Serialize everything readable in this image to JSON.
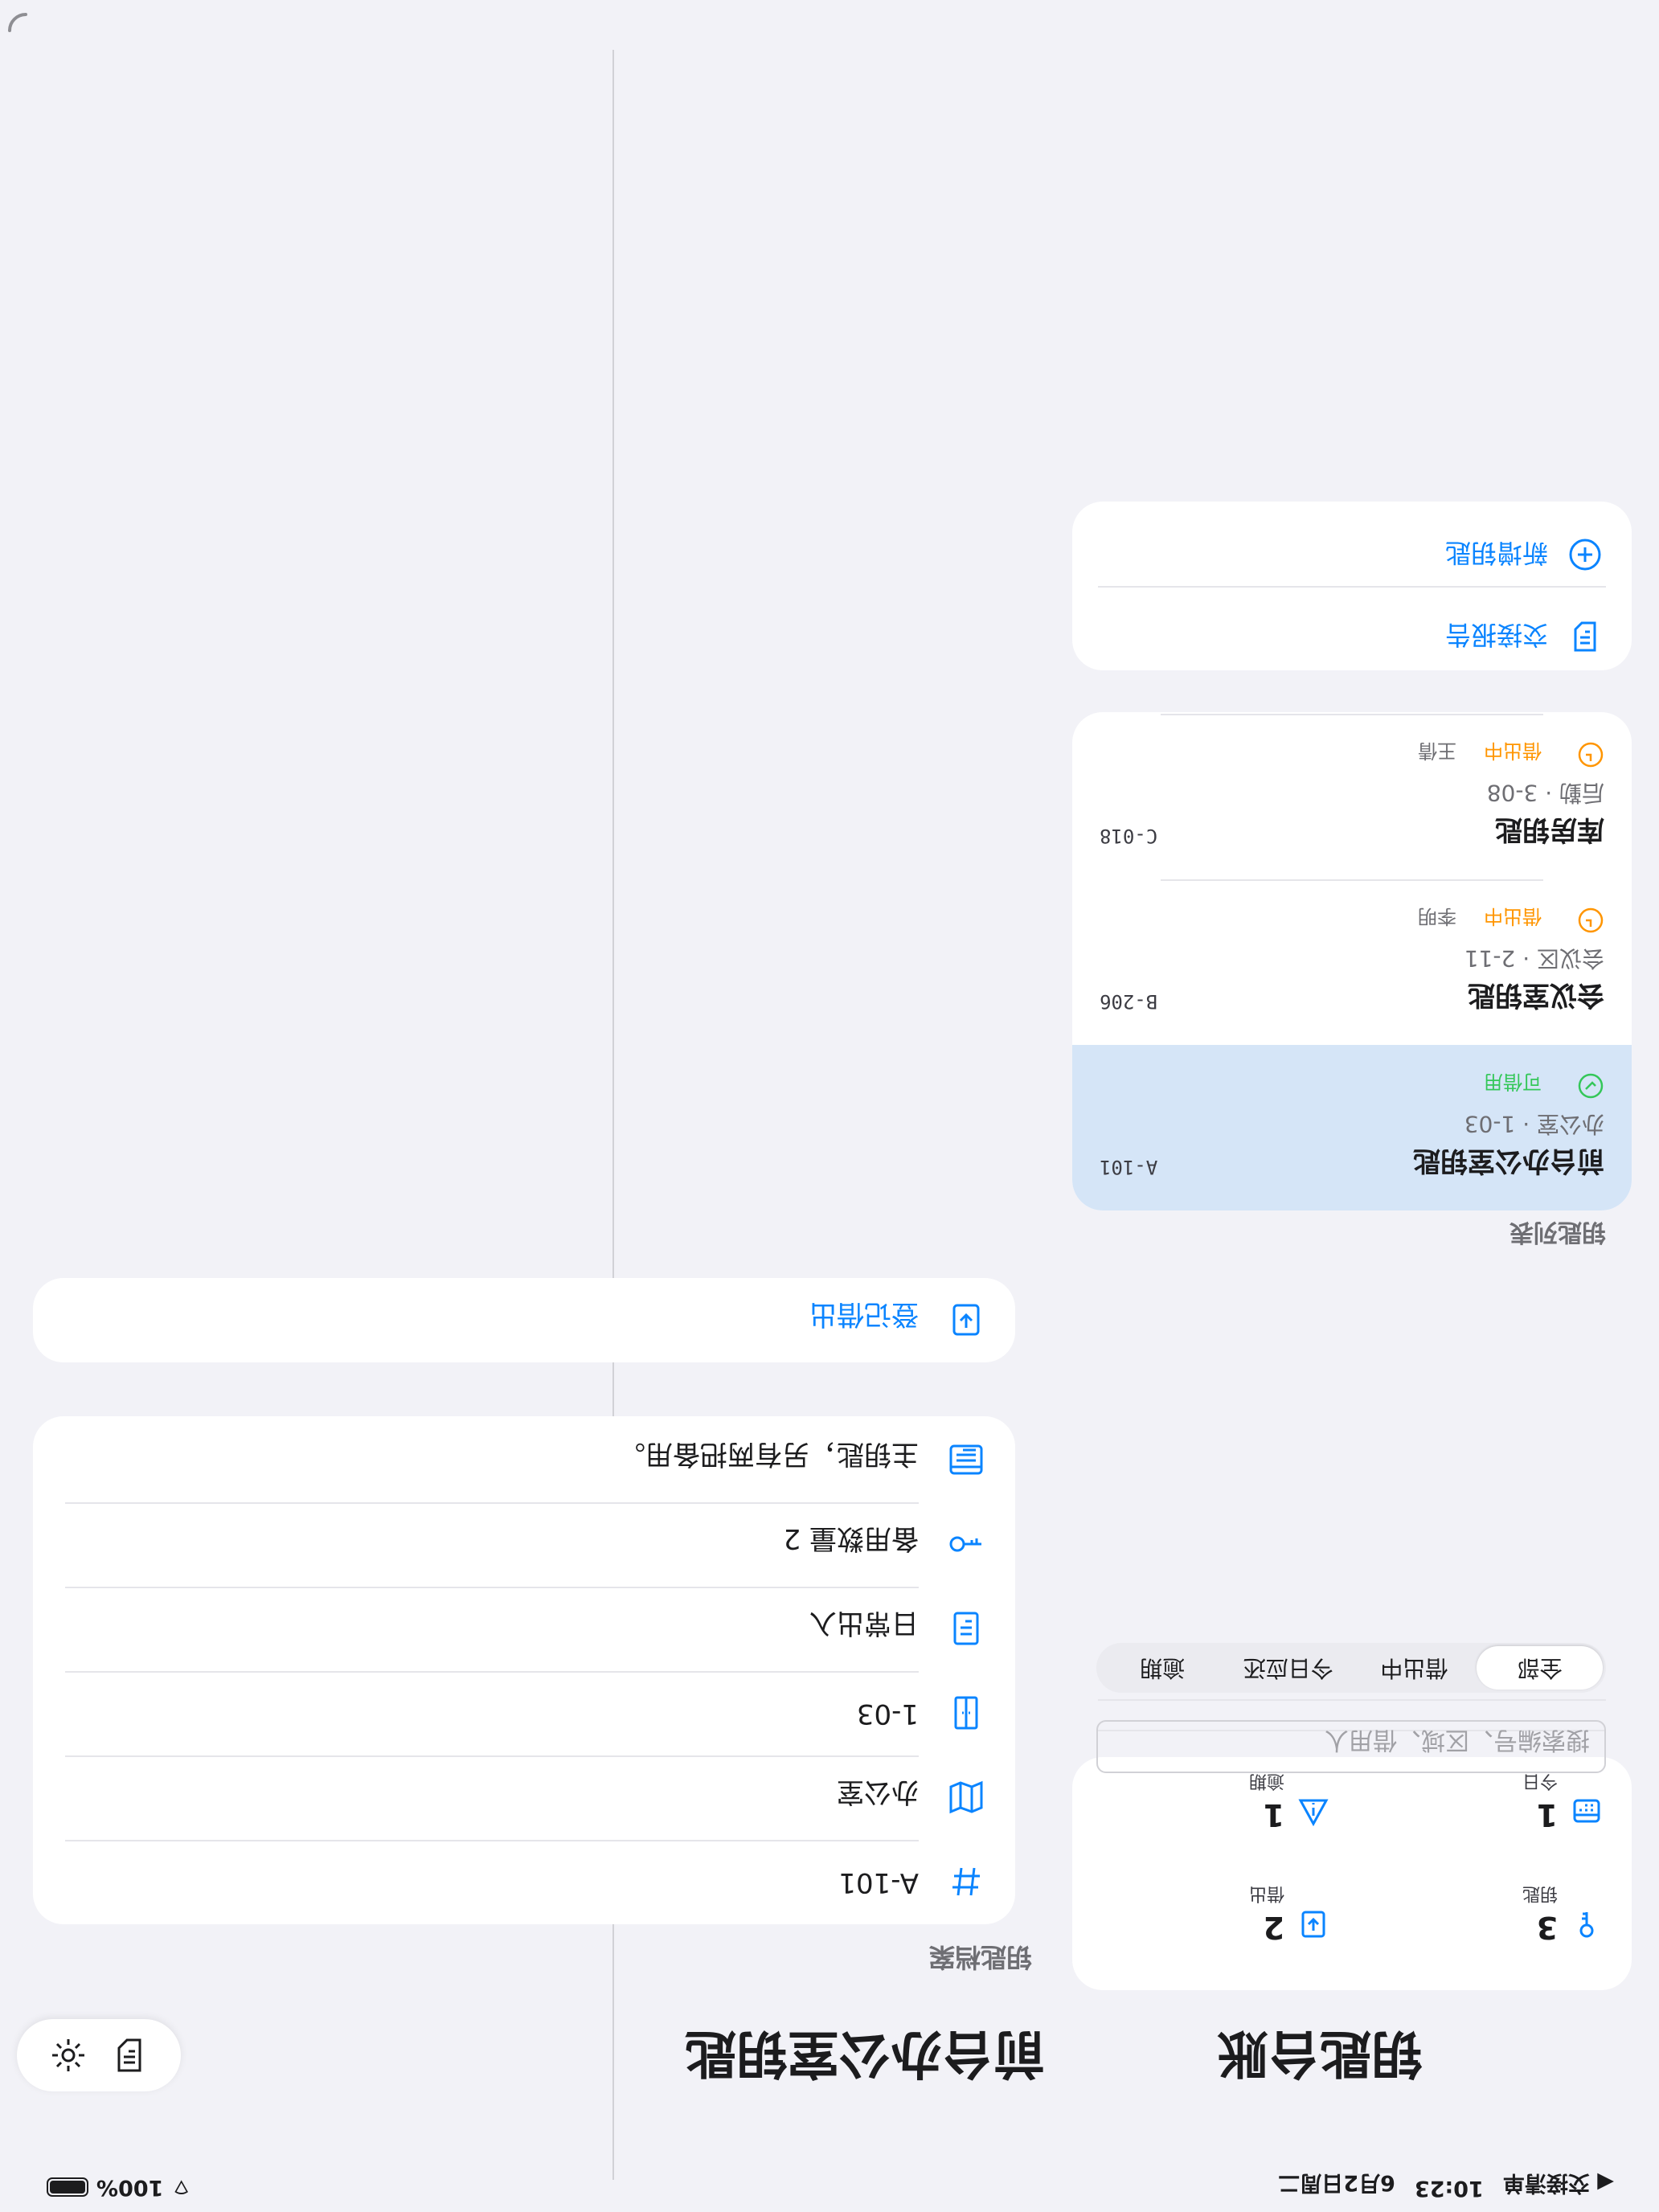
{
  "status_bar": {
    "app_back": "◀ 交接清单",
    "time": "10:23",
    "date": "6月2日周二",
    "battery": "100%"
  },
  "sidebar": {
    "title": "钥匙台账",
    "stats": [
      {
        "value": "3",
        "label": "钥匙",
        "icon": "key-icon"
      },
      {
        "value": "2",
        "label": "借出",
        "icon": "checkout-icon"
      },
      {
        "value": "1",
        "label": "今日",
        "icon": "calendar-icon"
      },
      {
        "value": "1",
        "label": "逾期",
        "icon": "warning-icon"
      }
    ],
    "search_placeholder": "搜索编号、区域、借用人",
    "filters": [
      "全部",
      "借出中",
      "今日应还",
      "逾期"
    ],
    "active_filter": "全部",
    "actions": {
      "add_key": "新增钥匙",
      "handover_report": "交接报告"
    },
    "list_title": "钥匙列表",
    "keys": [
      {
        "name": "前台办公室钥匙",
        "location": "办公室 · 1-03",
        "status": "可借用",
        "borrower": "",
        "code": "A-101",
        "status_color": "#34c759",
        "selected": true
      },
      {
        "name": "会议室钥匙",
        "location": "会议区 · 2-11",
        "status": "借出中",
        "borrower": "李明",
        "code": "B-206",
        "status_color": "#ff9500",
        "selected": false
      },
      {
        "name": "库房钥匙",
        "location": "后勤 · 3-08",
        "status": "借出中",
        "borrower": "王倩",
        "code": "C-018",
        "status_color": "#ff9500",
        "selected": false
      }
    ]
  },
  "detail": {
    "title": "前台办公室钥匙",
    "section_title": "钥匙档案",
    "rows": [
      {
        "icon": "hash-icon",
        "text": "A-101"
      },
      {
        "icon": "map-icon",
        "text": "办公室"
      },
      {
        "icon": "door-icon",
        "text": "1-03"
      },
      {
        "icon": "document-icon",
        "text": "日常出入"
      },
      {
        "icon": "key-icon",
        "text": "备用数量 2"
      },
      {
        "icon": "notes-icon",
        "text": "主钥匙，另有两把备用。"
      }
    ],
    "borrow_label": "登记借出"
  },
  "colors": {
    "accent": "#0a84ff",
    "available": "#34c759",
    "borrowed": "#ff9500",
    "selected_row": "#d5e5f7"
  }
}
